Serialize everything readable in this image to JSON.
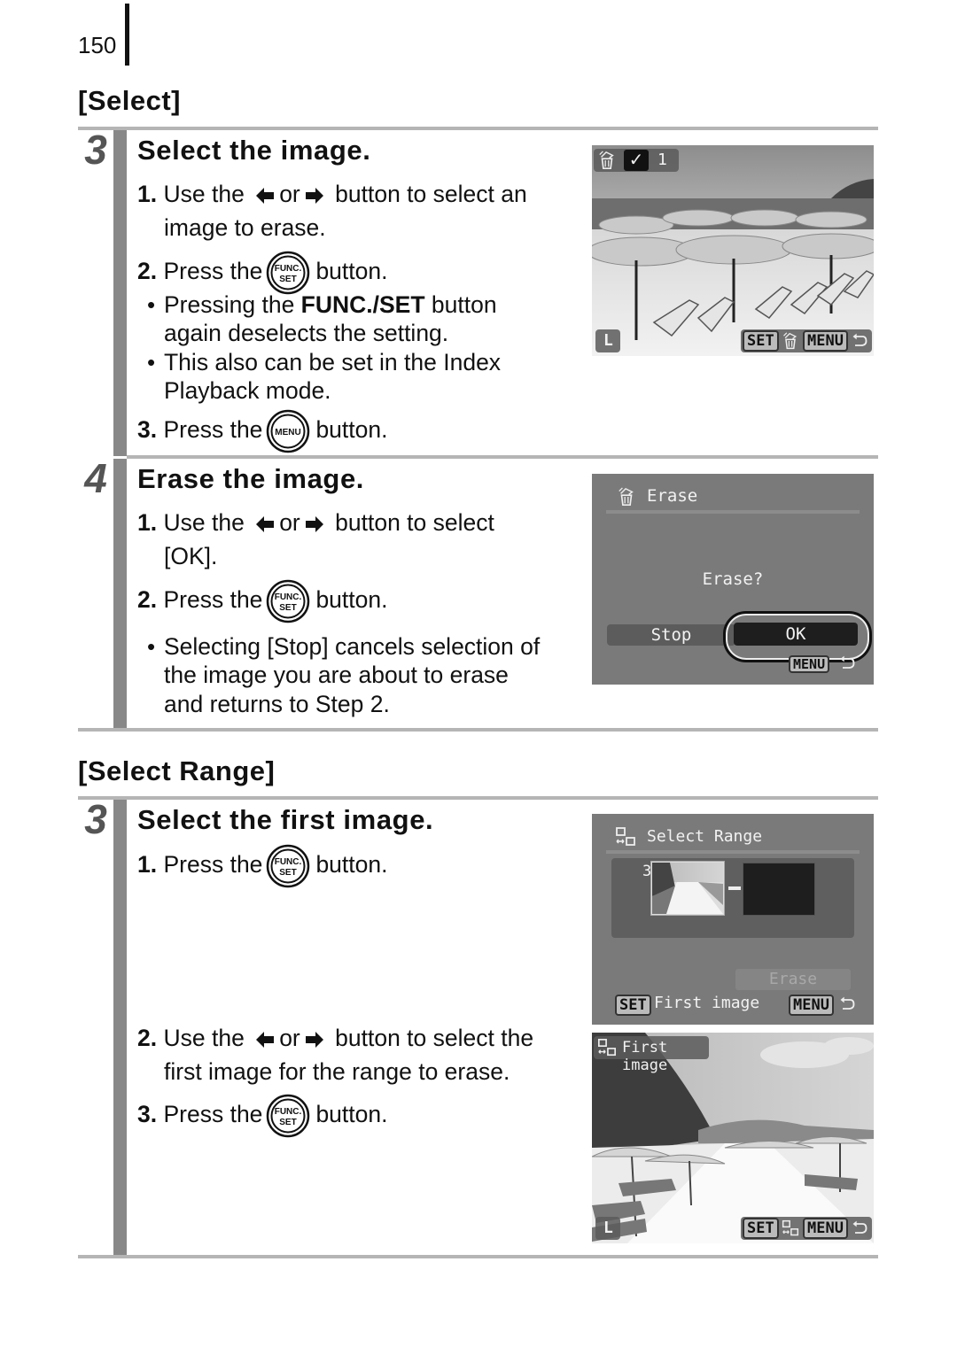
{
  "page": {
    "number": "150"
  },
  "icons": {
    "left_arrow": "left-arrow-icon",
    "right_arrow": "right-arrow-icon",
    "func_set_button": "func-set-button-icon",
    "menu_button": "menu-button-icon",
    "erase_icon": "trash-erase-icon",
    "select_range_icon": "select-range-icon",
    "check_icon": "checkmark-icon",
    "return_icon": "return-arrow-icon"
  },
  "select_section": {
    "title": "[Select]",
    "step3": {
      "number": "3",
      "title": "Select the image.",
      "item1": {
        "num": "1.",
        "pre": "Use the",
        "or": "or",
        "post": "button to select an",
        "line2": "image to erase."
      },
      "item2": {
        "num": "2.",
        "pre": "Press the",
        "post": "button."
      },
      "bullet1": {
        "pre": "Pressing the ",
        "bold": "FUNC./SET",
        "post": " button",
        "line2": "again deselects the setting."
      },
      "bullet2": {
        "line1": "This also can be set in the Index",
        "line2": "Playback mode."
      },
      "item3": {
        "num": "3.",
        "pre": "Press the",
        "post": "button."
      },
      "screen": {
        "selection_count": "1",
        "set_key": "SET",
        "menu_key": "MENU",
        "quality_label": "L"
      }
    },
    "step4": {
      "number": "4",
      "title": "Erase the image.",
      "item1": {
        "num": "1.",
        "pre": "Use the",
        "or": "or",
        "post": "button to select",
        "line2": "[OK]."
      },
      "item2": {
        "num": "2.",
        "pre": "Press the",
        "post": "button."
      },
      "bullet1": {
        "line1": "Selecting [Stop] cancels selection of",
        "line2": "the image you are about to erase",
        "line3": "and returns to Step 2."
      },
      "screen": {
        "title": "Erase",
        "prompt": "Erase?",
        "stop_label": "Stop",
        "ok_label": "OK",
        "menu_key": "MENU"
      }
    }
  },
  "select_range_section": {
    "title": "[Select Range]",
    "step3": {
      "number": "3",
      "title": "Select the first image.",
      "item1": {
        "num": "1.",
        "pre": "Press the",
        "post": "button."
      },
      "item2": {
        "num": "2.",
        "pre": "Use the",
        "or": "or",
        "post": "button to select the",
        "line2": "first image for the range to erase."
      },
      "item3": {
        "num": "3.",
        "pre": "Press the",
        "post": "button."
      },
      "screen1": {
        "title": "Select Range",
        "first_index": "3",
        "erase_label": "Erase",
        "set_key": "SET",
        "set_hint": "First image",
        "menu_key": "MENU"
      },
      "screen2": {
        "overlay_label": "First image",
        "set_key": "SET",
        "menu_key": "MENU",
        "quality_label": "L"
      }
    }
  }
}
